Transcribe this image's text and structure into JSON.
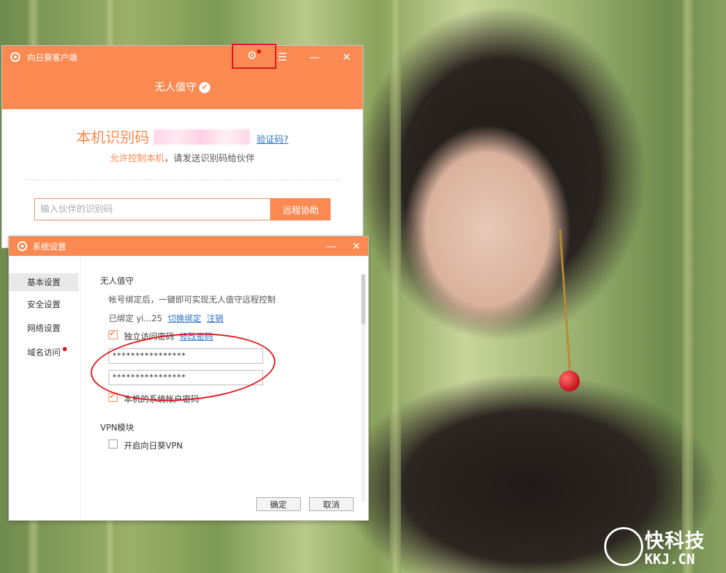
{
  "client": {
    "title": "向日葵客户端",
    "mode_label": "无人值守",
    "id_label": "本机识别码",
    "verify_link": "验证码?",
    "allow_control": "允许控制本机",
    "send_hint": "，请发送识别码给伙伴",
    "partner_placeholder": "输入伙伴的识别码",
    "remote_assist_button": "远程协助",
    "controls": {
      "menu": "☰",
      "minimize": "—",
      "close": "✕"
    }
  },
  "settings": {
    "title": "系统设置",
    "controls": {
      "minimize": "—",
      "close": "✕"
    },
    "sidebar": {
      "items": [
        {
          "label": "基本设置",
          "active": true
        },
        {
          "label": "安全设置",
          "active": false
        },
        {
          "label": "网络设置",
          "active": false
        },
        {
          "label": "域名访问",
          "active": false,
          "badge": true
        }
      ]
    },
    "unattended": {
      "title": "无人值守",
      "desc": "帐号绑定后，一键即可实现无人值守远程控制",
      "bound_account": "已绑定 yi...25",
      "switch_binding": "切换绑定",
      "logout": "注销",
      "independent_password": {
        "label": "独立访问密码",
        "checked": true
      },
      "change_password": "修改密码",
      "password": "****************",
      "password_confirm": "****************",
      "system_account_password": {
        "label": "本机的系统帐户密码",
        "checked": true
      }
    },
    "vpn": {
      "title": "VPN模块",
      "enable": {
        "label": "开启向日葵VPN",
        "checked": false
      }
    },
    "ok_button": "确定",
    "cancel_button": "取消"
  },
  "watermark": {
    "cn": "快科技",
    "en": "KKJ.CN"
  },
  "colors": {
    "accent": "#fa8a52",
    "highlight_red": "#e0131b",
    "link": "#2a72c8"
  }
}
